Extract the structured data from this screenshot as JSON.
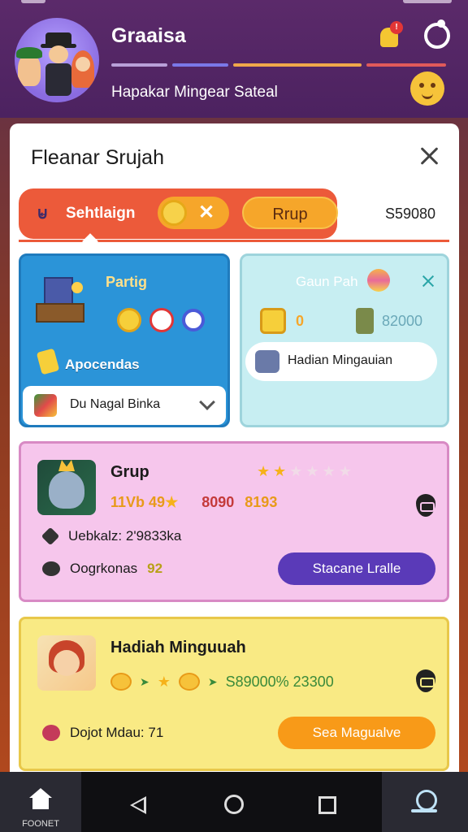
{
  "header": {
    "title": "Graaisa",
    "subtitle": "Hapakar Mingear Sateal",
    "notification_count": "!"
  },
  "panel": {
    "title": "Fleanar Srujah",
    "tabs": {
      "active_label": "Sehtlaign",
      "secondary_label": "Rrup",
      "amount": "S59080"
    },
    "featured": [
      {
        "title": "Partig",
        "sub_label": "Apocendas",
        "chip_label": "Du Nagal Binka"
      },
      {
        "title": "Gaun Pah",
        "value_mid": "0",
        "value_amount": "82000",
        "chip_label": "Hadian Mingauian"
      }
    ],
    "items": [
      {
        "title": "Grup",
        "rating_on": 2,
        "rating_total": 6,
        "stat_a": "11Vb 49",
        "stat_b": "8090",
        "stat_c": "8193",
        "meta1_label": "Uebkalz: 2'9833ka",
        "meta2_label": "Oogrkonas",
        "meta2_value": "92",
        "button_label": "Stacane Lralle"
      },
      {
        "title": "Hadiah Minguuah",
        "stat_line": "S89000% 23300",
        "meta_label": "Dojot Mdau: 71",
        "button_label": "Sea Magualve"
      }
    ]
  },
  "navbar": {
    "home_label": "FOONET"
  },
  "colors": {
    "header_bg": "#5b2a6a",
    "tab_bar": "#ec5a3a",
    "card_blue": "#2b94d8",
    "card_teal": "#c7eef2",
    "card_pink": "#f6c6ec",
    "card_yellow": "#f9ea84",
    "button_purple": "#5a3ab8",
    "button_orange": "#f89a18"
  },
  "icons": [
    "bell-icon",
    "settings-icon",
    "emoji-icon",
    "close-icon",
    "coin-icon",
    "home-icon",
    "back-icon",
    "circle-icon",
    "square-icon",
    "profile-icon"
  ]
}
